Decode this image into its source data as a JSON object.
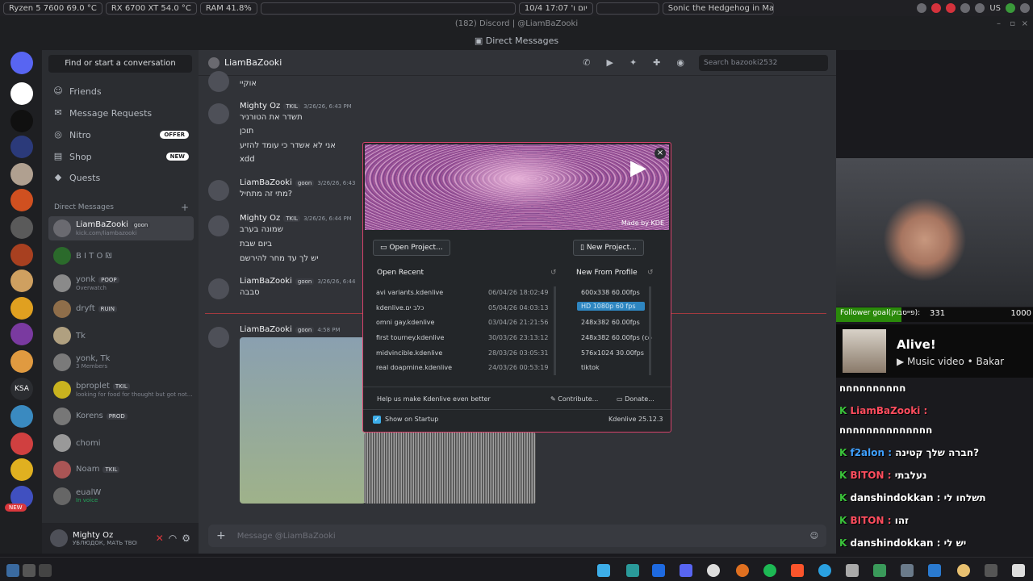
{
  "sysbar": {
    "cpu": "Ryzen 5 7600  69.0 °C",
    "gpu": "RX 6700 XT 54.0 °C",
    "ram": "RAM   41.8%",
    "clock": "10/4 יום ו' 17:07",
    "media": "Sonic the Hedgehog in Mas...",
    "lang": "US"
  },
  "window": {
    "title": "(182) Discord | @LiamBaZooki",
    "section": "Direct Messages"
  },
  "sidebar": {
    "search": "Find or start a conversation",
    "nav": [
      {
        "label": "Friends",
        "icon": "friends-icon"
      },
      {
        "label": "Message Requests",
        "icon": "mail-icon"
      },
      {
        "label": "Nitro",
        "icon": "nitro-icon",
        "badge": "OFFER"
      },
      {
        "label": "Shop",
        "icon": "shop-icon",
        "badge": "NEW"
      },
      {
        "label": "Quests",
        "icon": "quests-icon"
      }
    ],
    "dm_header": "Direct Messages",
    "dms": [
      {
        "name": "LiamBaZooki",
        "tag": "goon",
        "sub": "kick.com/liambazooki",
        "color": "#6a6a70"
      },
      {
        "name": "B I T O ₪",
        "tag": "",
        "sub": "",
        "color": "#2b6a2b"
      },
      {
        "name": "yonk",
        "tag": "POOP",
        "sub": "Overwatch",
        "color": "#8a8a8a"
      },
      {
        "name": "dryft",
        "tag": "RUIN",
        "sub": "",
        "color": "#8f6e4a"
      },
      {
        "name": "Tk",
        "tag": "",
        "sub": "",
        "color": "#b0a080"
      },
      {
        "name": "yonk, Tk",
        "tag": "",
        "sub": "3 Members",
        "color": "#7a7a7a"
      },
      {
        "name": "bproplet",
        "tag": "TKIL",
        "sub": "looking for food for thought but got not...",
        "color": "#c9b31f"
      },
      {
        "name": "Korens",
        "tag": "PROD",
        "sub": "",
        "color": "#777"
      },
      {
        "name": "chomi",
        "tag": "",
        "sub": "",
        "color": "#999"
      },
      {
        "name": "Noam",
        "tag": "TKIL",
        "sub": "",
        "color": "#a55"
      },
      {
        "name": "eualW",
        "tag": "",
        "sub": "In voice",
        "color": "#666"
      }
    ],
    "user": {
      "name": "Mighty Oz",
      "status": "УБЛЮДОК, МАТЬ ТВОЮ"
    },
    "new_badge": "NEW"
  },
  "chat": {
    "recipient": "LiamBaZooki",
    "search_placeholder": "Search bazooki2532",
    "input_placeholder": "Message @LiamBaZooki",
    "messages": [
      {
        "author": "",
        "time": "",
        "lines": [
          "אוקיי"
        ]
      },
      {
        "author": "Mighty Oz",
        "tag": "TKIL",
        "time": "3/26/26, 6:43 PM",
        "lines": [
          "תשדר את הטורניר",
          "תוכן",
          "אני לא אשדר כי עומד להזיע",
          "xdd"
        ]
      },
      {
        "author": "LiamBaZooki",
        "tag": "goon",
        "time": "3/26/26, 6:43",
        "lines": [
          "מתי זה מתחיל?"
        ]
      },
      {
        "author": "Mighty Oz",
        "tag": "TKIL",
        "time": "3/26/26, 6:44 PM",
        "lines": [
          "שמונה בערב",
          "ביום שבת",
          "יש לך עד מחר להירשם"
        ]
      },
      {
        "author": "LiamBaZooki",
        "tag": "goon",
        "time": "3/26/26, 6:44",
        "lines": [
          "סבבה"
        ]
      },
      {
        "author": "LiamBaZooki",
        "tag": "goon",
        "time": "4:58 PM",
        "lines": []
      }
    ]
  },
  "kdenlive": {
    "made_by": "Made by KDE",
    "open_project": "Open Project...",
    "new_project": "New Project...",
    "open_recent": "Open Recent",
    "new_from_profile": "New From Profile",
    "recent": [
      {
        "name": "avi variants.kdenlive",
        "date": "06/04/26 18:02:49"
      },
      {
        "name": "kdenlive.כלב ים",
        "date": "05/04/26 04:03:13"
      },
      {
        "name": "omni gay.kdenlive",
        "date": "03/04/26 21:21:56"
      },
      {
        "name": "first tourney.kdenlive",
        "date": "30/03/26 23:13:12"
      },
      {
        "name": "midvincible.kdenlive",
        "date": "28/03/26 03:05:31"
      },
      {
        "name": "real doapmine.kdenlive",
        "date": "24/03/26 00:53:19"
      }
    ],
    "profiles": [
      "600x338 60.00fps",
      "HD 1080p 60 fps",
      "248x382 60.00fps",
      "248x382 60.00fps (co",
      "576x1024 30.00fps",
      "tiktok"
    ],
    "help": "Help us make Kdenlive even better",
    "contribute": "Contribute...",
    "donate": "Donate...",
    "show_startup": "Show on Startup",
    "version": "Kdenlive 25.12.3"
  },
  "stream": {
    "goal_label": "Follower goal(פייסבוק):",
    "goal_current": "331",
    "goal_target": "1000",
    "goal_fraction": 0.331,
    "music_title": "Alive!",
    "music_sub": "Music video • Bakar",
    "chat": [
      {
        "user": "",
        "text": "חחחחחחחחחח",
        "color": "#ffffff"
      },
      {
        "user": "LiamBaZooki :",
        "text": "",
        "color": "#ff4d5e"
      },
      {
        "user": "",
        "text": "חחחחחחחחחחחחחח",
        "color": "#ffffff"
      },
      {
        "user": "f2alon :",
        "text": "חברה שלך קטינה?",
        "color": "#3fa0ff"
      },
      {
        "user": "BITON :",
        "text": "נעלבתי",
        "color": "#ff4d5e"
      },
      {
        "user": "danshindokkan :",
        "text": "תשלחו לי",
        "color": "#ffffff"
      },
      {
        "user": "BITON :",
        "text": "זהו",
        "color": "#ff4d5e"
      },
      {
        "user": "danshindokkan :",
        "text": "יש לי",
        "color": "#ffffff"
      }
    ]
  }
}
